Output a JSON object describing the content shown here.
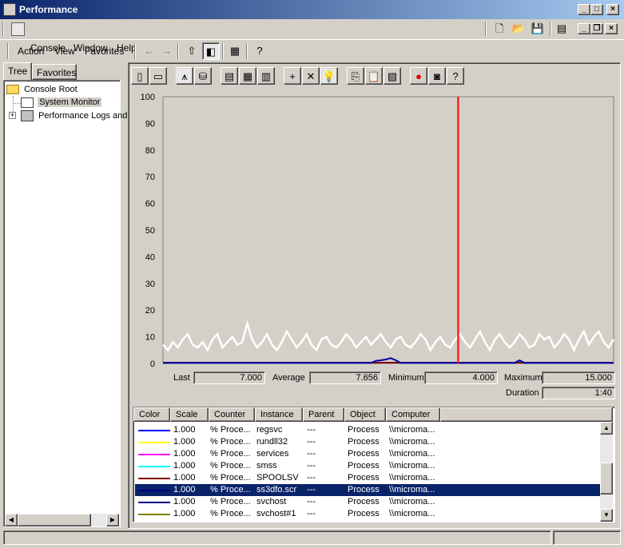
{
  "window": {
    "title": "Performance",
    "caption_buttons": [
      "minimize-icon",
      "maximize-icon",
      "close-icon"
    ]
  },
  "menubar": {
    "items": [
      {
        "label": "Console",
        "accel": "C"
      },
      {
        "label": "Window",
        "accel": "W"
      },
      {
        "label": "Help",
        "accel": "H"
      }
    ]
  },
  "actionbar": {
    "items": [
      {
        "label": "Action",
        "accel": "A"
      },
      {
        "label": "View",
        "accel": "V"
      },
      {
        "label": "Favorites",
        "accel": "F"
      }
    ]
  },
  "tabs": [
    {
      "label": "Tree",
      "active": true
    },
    {
      "label": "Favorites",
      "active": false
    }
  ],
  "tree": {
    "items": [
      {
        "label": "Console Root",
        "icon": "folder-icon"
      },
      {
        "label": "System Monitor",
        "icon": "system-monitor-icon",
        "selected": true
      },
      {
        "label": "Performance Logs and",
        "icon": "performance-logs-icon"
      }
    ]
  },
  "graph_toolbar": {
    "buttons": [
      "new-counter-set-icon",
      "clear-display-icon",
      "view-current-activity-icon",
      "view-log-data-icon",
      "view-graph-icon",
      "view-histogram-icon",
      "view-report-icon",
      "add-counter-icon",
      "delete-counter-icon",
      "highlight-icon",
      "copy-properties-icon",
      "paste-counter-list-icon",
      "properties-icon",
      "freeze-display-icon",
      "update-data-icon",
      "help-icon"
    ]
  },
  "chart_data": {
    "type": "line",
    "ylim": [
      0,
      100
    ],
    "yticks": [
      100,
      90,
      80,
      70,
      60,
      50,
      40,
      30,
      20,
      10,
      0
    ],
    "grid": false,
    "legend": "none",
    "series": [
      {
        "color": "#ffffff",
        "values": [
          7,
          5,
          8,
          6,
          9,
          11,
          7,
          6,
          8,
          5,
          9,
          11,
          6,
          8,
          10,
          7,
          8,
          15,
          9,
          6,
          8,
          11,
          7,
          5,
          8,
          12,
          9,
          6,
          8,
          11,
          7,
          5,
          9,
          10,
          7,
          6,
          8,
          11,
          9,
          6,
          8,
          10,
          7,
          9,
          11,
          8,
          6,
          9,
          10,
          7,
          6,
          8,
          11,
          9,
          5,
          8,
          10,
          7,
          6,
          9,
          11,
          8,
          6,
          9,
          12,
          8,
          5,
          9,
          11,
          8,
          6,
          8,
          11,
          9,
          6,
          7,
          11,
          9,
          10,
          6,
          8,
          11,
          9,
          5,
          9,
          12,
          7,
          10,
          12,
          8,
          6,
          9
        ]
      },
      {
        "color": "#0000aa",
        "values": [
          0.2,
          0.2,
          0.2,
          0.2,
          0.2,
          0.2,
          0.2,
          0.2,
          0.2,
          0.2,
          0.2,
          0.2,
          0.2,
          0.2,
          0.2,
          0.2,
          0.2,
          0.2,
          0.2,
          0.2,
          0.2,
          0.2,
          0.2,
          0.2,
          0.2,
          0.2,
          0.2,
          0.2,
          0.2,
          0.2,
          0.2,
          0.2,
          0.2,
          0.2,
          0.2,
          0.2,
          0.2,
          0.2,
          0.2,
          0.2,
          0.2,
          0.2,
          0.2,
          1.0,
          1.2,
          1.5,
          2.0,
          1.2,
          0.2,
          0.2,
          0.2,
          0.2,
          0.2,
          0.2,
          0.2,
          0.2,
          0.2,
          0.2,
          0.2,
          0.2,
          0.2,
          0.2,
          0.2,
          0.2,
          0.2,
          0.2,
          0.2,
          0.2,
          0.2,
          0.2,
          0.2,
          0.2,
          1.2,
          0.2,
          0.2,
          0.2,
          0.2,
          0.2,
          0.2,
          0.2,
          0.2,
          0.2,
          0.2,
          0.2,
          0.2,
          0.2,
          0.2,
          0.2,
          0.2,
          0.2,
          0.2,
          0.2
        ]
      },
      {
        "color": "#800000",
        "values": [
          0.3,
          0.3,
          0.3,
          0.3,
          0.3,
          0.3,
          0.3,
          0.3,
          0.3,
          0.3,
          0.3,
          0.3,
          0.3,
          0.3,
          0.3,
          0.3,
          0.3,
          0.3,
          0.3,
          0.3,
          0.3,
          0.3,
          0.3,
          0.3,
          0.3,
          0.3,
          0.3,
          0.3,
          0.3,
          0.3,
          0.3,
          0.3,
          0.3,
          0.3,
          0.3,
          0.3,
          0.3,
          0.3,
          0.3,
          0.3,
          0.3,
          0.3,
          0.3,
          0.3,
          0.3,
          0.3,
          0.3,
          0.3,
          0.3,
          0.3,
          0.3,
          0.3,
          0.3,
          0.3,
          0.3,
          0.3,
          0.3,
          0.3,
          0.3,
          0.3,
          0.3,
          0.3,
          0.3,
          0.3,
          0.3,
          0.3,
          0.3,
          0.3,
          0.3,
          0.3,
          0.3,
          0.3,
          0.3,
          0.3,
          0.3,
          0.3,
          0.3,
          0.3,
          0.3,
          0.3,
          0.3,
          0.3,
          0.3,
          0.3,
          0.3,
          0.3,
          0.3,
          0.3,
          0.3,
          0.3,
          0.3,
          0.3
        ]
      }
    ],
    "cursor_fraction": 0.655,
    "cursor_color": "#ff0000"
  },
  "stats": {
    "last_label": "Last",
    "last_value": "7.000",
    "average_label": "Average",
    "average_value": "7.656",
    "minimum_label": "Minimum",
    "minimum_value": "4.000",
    "maximum_label": "Maximum",
    "maximum_value": "15.000",
    "duration_label": "Duration",
    "duration_value": "1:40"
  },
  "counters": {
    "columns": [
      "Color",
      "Scale",
      "Counter",
      "Instance",
      "Parent",
      "Object",
      "Computer"
    ],
    "rows": [
      {
        "color": "#0000ff",
        "scale": "1.000",
        "counter": "% Proce...",
        "instance": "regsvc",
        "parent": "---",
        "object": "Process",
        "computer": "\\\\microma..."
      },
      {
        "color": "#ffff00",
        "scale": "1.000",
        "counter": "% Proce...",
        "instance": "rundll32",
        "parent": "---",
        "object": "Process",
        "computer": "\\\\microma..."
      },
      {
        "color": "#ff00ff",
        "scale": "1.000",
        "counter": "% Proce...",
        "instance": "services",
        "parent": "---",
        "object": "Process",
        "computer": "\\\\microma..."
      },
      {
        "color": "#00ffff",
        "scale": "1.000",
        "counter": "% Proce...",
        "instance": "smss",
        "parent": "---",
        "object": "Process",
        "computer": "\\\\microma..."
      },
      {
        "color": "#800000",
        "scale": "1.000",
        "counter": "% Proce...",
        "instance": "SPOOLSV",
        "parent": "---",
        "object": "Process",
        "computer": "\\\\microma..."
      },
      {
        "color": "#000080",
        "scale": "1.000",
        "counter": "% Proce...",
        "instance": "ss3dfo.scr",
        "parent": "---",
        "object": "Process",
        "computer": "\\\\microma...",
        "selected": true
      },
      {
        "color": "#000080",
        "scale": "1.000",
        "counter": "% Proce...",
        "instance": "svchost",
        "parent": "---",
        "object": "Process",
        "computer": "\\\\microma..."
      },
      {
        "color": "#808000",
        "scale": "1.000",
        "counter": "% Proce...",
        "instance": "svchost#1",
        "parent": "---",
        "object": "Process",
        "computer": "\\\\microma..."
      }
    ]
  }
}
